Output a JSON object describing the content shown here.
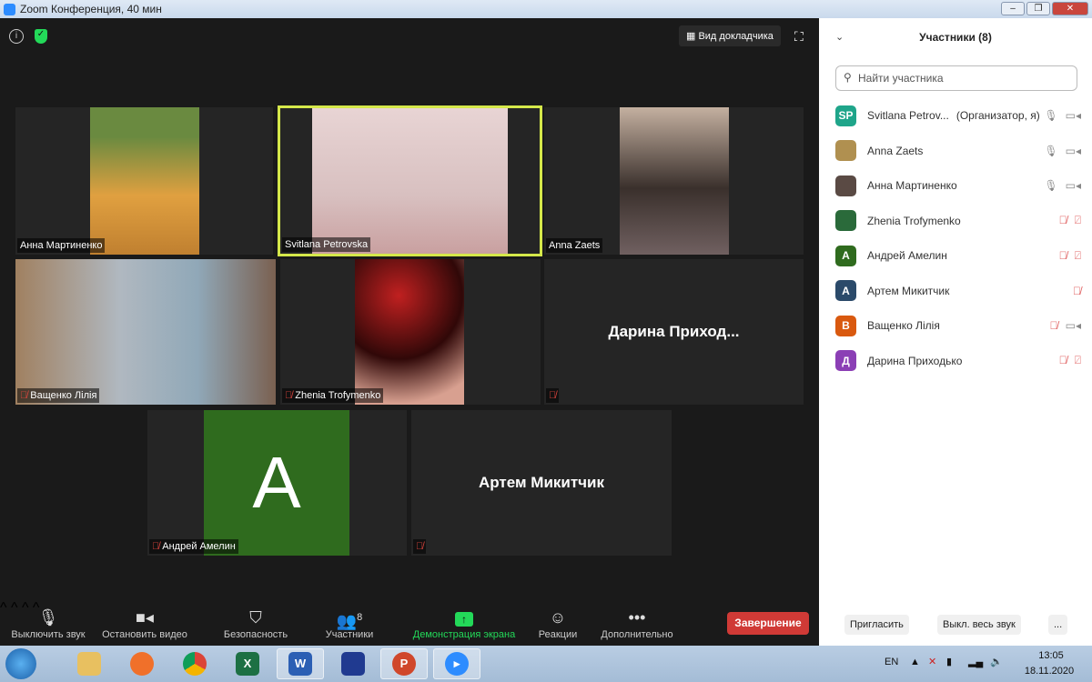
{
  "window": {
    "title": "Zoom Конференция, 40 мин",
    "buttons": [
      "–",
      "❐",
      "✕"
    ]
  },
  "top": {
    "speaker_view": "Вид докладчика",
    "info_icon": "i",
    "shield_icon": "✓"
  },
  "tiles": [
    {
      "name": "Анна Мартиненко",
      "muted": false,
      "video": true,
      "color": "#b07a30"
    },
    {
      "name": "Svitlana Petrovska",
      "muted": false,
      "video": true,
      "active": true,
      "color": "#d9c5c5"
    },
    {
      "name": "Anna Zaets",
      "muted": false,
      "video": true,
      "color": "#4a3a34"
    },
    {
      "name": "Ващенко Лілія",
      "muted": true,
      "video": true,
      "color": "#8a94a0"
    },
    {
      "name": "Zhenia Trofymenko",
      "muted": true,
      "video": true,
      "color": "#6a1010"
    },
    {
      "name": "",
      "big_name": "Дарина Приход...",
      "muted": true,
      "video": false
    },
    {
      "name": "Андрей Амелин",
      "muted": true,
      "video": false,
      "avatar_letter": "A",
      "color": "#2f6b1e"
    },
    {
      "name": "",
      "big_name": "Артем Микитчик",
      "muted": true,
      "video": false
    }
  ],
  "toolbar": {
    "mute": "Выключить звук",
    "video": "Остановить видео",
    "security": "Безопасность",
    "participants": "Участники",
    "participants_count": "8",
    "share": "Демонстрация экрана",
    "reactions": "Реакции",
    "more": "Дополнительно",
    "end": "Завершение"
  },
  "panel": {
    "title": "Участники (8)",
    "search_placeholder": "Найти участника",
    "participants": [
      {
        "name": "Svitlana Petrov...",
        "role": "(Организатор, я)",
        "initials": "SP",
        "color": "#1fa58a",
        "mic": "on",
        "cam": "on"
      },
      {
        "name": "Anna Zaets",
        "initials": "",
        "color": "#b09050",
        "mic": "on",
        "cam": "on"
      },
      {
        "name": "Анна Мартиненко",
        "initials": "",
        "color": "#5a4a44",
        "mic": "on",
        "cam": "on"
      },
      {
        "name": "Zhenia Trofymenko",
        "initials": "",
        "color": "#2a6a3a",
        "mic": "off",
        "cam": "off"
      },
      {
        "name": "Андрей Амелин",
        "initials": "A",
        "color": "#2f6b1e",
        "mic": "off",
        "cam": "off"
      },
      {
        "name": "Артем Микитчик",
        "initials": "A",
        "color": "#2b4a6a",
        "mic": "off",
        "cam": "none"
      },
      {
        "name": "Ващенко Лілія",
        "initials": "B",
        "color": "#d9590f",
        "mic": "off",
        "cam": "on"
      },
      {
        "name": "Дарина Приходько",
        "initials": "Д",
        "color": "#8b3fb5",
        "mic": "off",
        "cam": "off"
      }
    ],
    "invite": "Пригласить",
    "mute_all": "Выкл. весь звук",
    "more": "..."
  },
  "taskbar": {
    "lang": "EN",
    "time": "13:05",
    "date": "18.11.2020",
    "apps": [
      "explorer",
      "firefox",
      "chrome",
      "excel",
      "word",
      "save",
      "powerpoint",
      "zoom"
    ]
  }
}
